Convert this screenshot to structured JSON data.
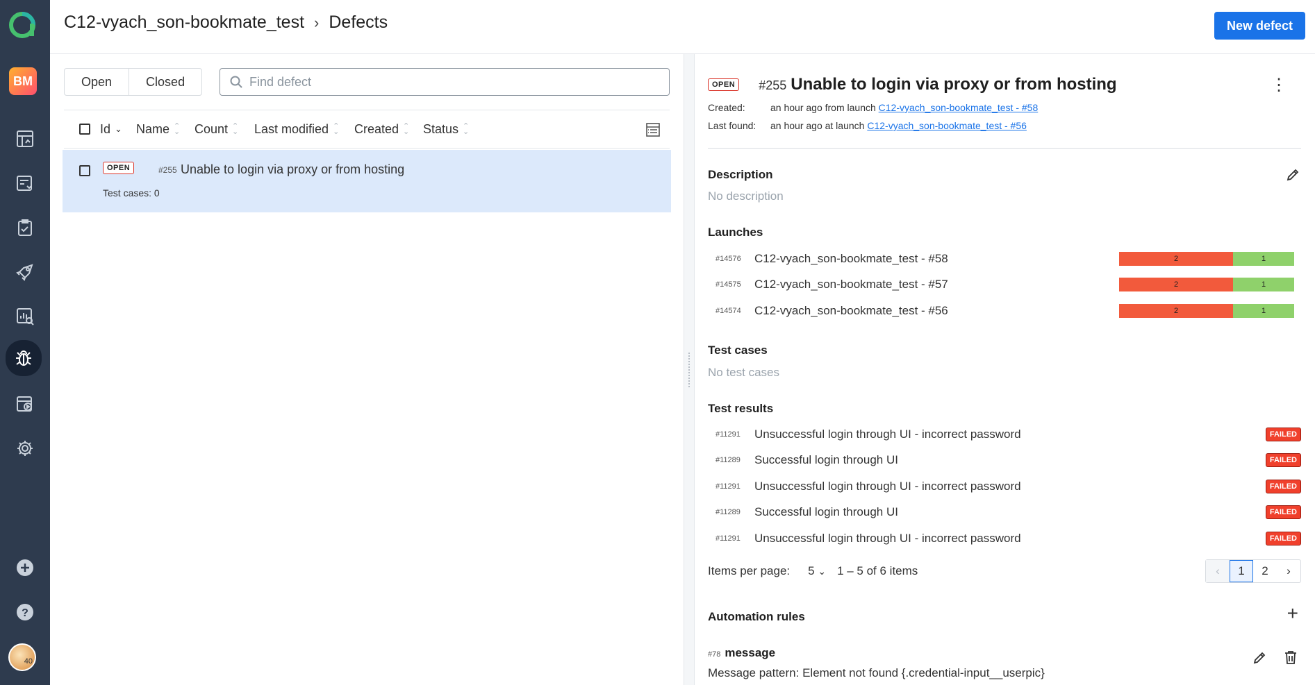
{
  "sidebar": {
    "logo_icon": "allure-logo-icon",
    "project_badge": "BM",
    "items": [
      {
        "name": "dashboards-icon"
      },
      {
        "name": "launches-icon"
      },
      {
        "name": "test-cases-icon"
      },
      {
        "name": "jobs-icon"
      },
      {
        "name": "analytics-icon"
      },
      {
        "name": "defects-icon",
        "active": true
      },
      {
        "name": "test-plans-icon"
      },
      {
        "name": "settings-icon"
      }
    ],
    "avatar_text": "40"
  },
  "header": {
    "project": "C12-vyach_son-bookmate_test",
    "page": "Defects",
    "new_button": "New defect"
  },
  "list": {
    "tabs": [
      "Open",
      "Closed"
    ],
    "search_placeholder": "Find defect",
    "columns": [
      "Id",
      "Name",
      "Count",
      "Last modified",
      "Created",
      "Status"
    ],
    "rows": [
      {
        "status": "OPEN",
        "id": "#255",
        "name": "Unable to login via proxy or from hosting",
        "sub": "Test cases: 0"
      }
    ]
  },
  "detail": {
    "status": "OPEN",
    "id": "#255",
    "title": "Unable to login via proxy or from hosting",
    "created_label": "Created:",
    "created_text": "an hour ago from launch",
    "created_link": "C12-vyach_son-bookmate_test - #58",
    "last_found_label": "Last found:",
    "last_found_text": "an hour ago at launch",
    "last_found_link": "C12-vyach_son-bookmate_test - #56",
    "description_title": "Description",
    "description_value": "No description",
    "launches_title": "Launches",
    "launches": [
      {
        "id": "#14576",
        "name": "C12-vyach_son-bookmate_test - #58",
        "failed": 2,
        "passed": 1
      },
      {
        "id": "#14575",
        "name": "C12-vyach_son-bookmate_test - #57",
        "failed": 2,
        "passed": 1
      },
      {
        "id": "#14574",
        "name": "C12-vyach_son-bookmate_test - #56",
        "failed": 2,
        "passed": 1
      }
    ],
    "test_cases_title": "Test cases",
    "test_cases_value": "No test cases",
    "test_results_title": "Test results",
    "test_results": [
      {
        "id": "#11291",
        "name": "Unsuccessful login through UI - incorrect password",
        "status": "FAILED"
      },
      {
        "id": "#11289",
        "name": "Successful login through UI",
        "status": "FAILED"
      },
      {
        "id": "#11291",
        "name": "Unsuccessful login through UI - incorrect password",
        "status": "FAILED"
      },
      {
        "id": "#11289",
        "name": "Successful login through UI",
        "status": "FAILED"
      },
      {
        "id": "#11291",
        "name": "Unsuccessful login through UI - incorrect password",
        "status": "FAILED"
      }
    ],
    "pagination": {
      "items_per_page_label": "Items per page:",
      "items_per_page": "5",
      "range": "1 – 5 of 6 items",
      "pages": [
        "1",
        "2"
      ],
      "current": "1"
    },
    "automation_title": "Automation rules",
    "rule_id": "#78",
    "rule_name": "message",
    "rule_pattern": "Message pattern: Element not found {.credential-input__userpic}"
  },
  "colors": {
    "sidebar": "#2e3b4e",
    "accent": "#1a73e8",
    "failed": "#f25a3c",
    "passed": "#8fd16b",
    "selected_row": "#dce9fb"
  }
}
